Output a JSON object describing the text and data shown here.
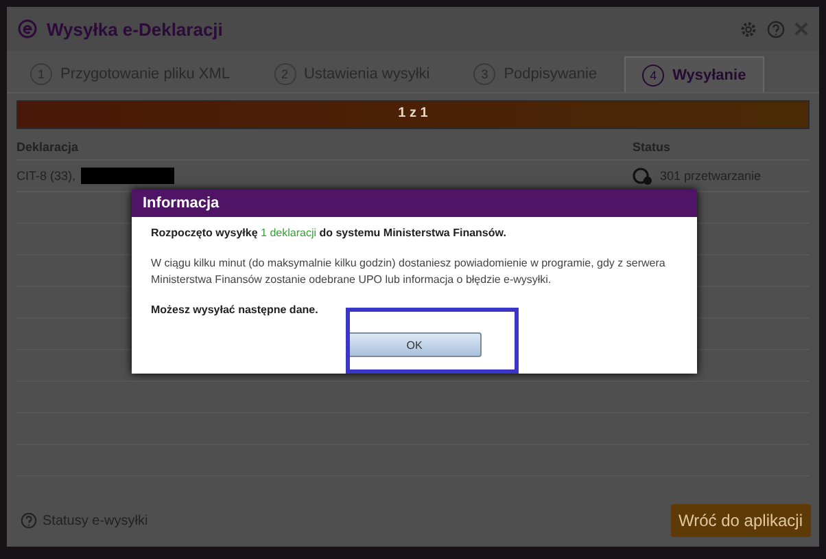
{
  "window": {
    "title": "Wysyłka e-Deklaracji"
  },
  "tabs": [
    {
      "number": "1",
      "label": "Przygotowanie pliku XML",
      "selected": false
    },
    {
      "number": "2",
      "label": "Ustawienia wysyłki",
      "selected": false
    },
    {
      "number": "3",
      "label": "Podpisywanie",
      "selected": false
    },
    {
      "number": "4",
      "label": "Wysyłanie",
      "selected": true
    }
  ],
  "progress": {
    "level": 1,
    "text": "1 z 1"
  },
  "table": {
    "columns": [
      "Deklaracja",
      "Status"
    ],
    "rows": [
      {
        "deklaracja": "CIT-8 (33),",
        "redacted": true,
        "status": "301 przetwarzanie"
      }
    ]
  },
  "footer": {
    "help_link": "Statusy e-wysyłki",
    "back_button": "Wróć do aplikacji"
  },
  "dialog": {
    "title": "Informacja",
    "lines": [
      "**Rozpoczęto wysyłkę** 1 deklaracji **do systemu Ministerstwa Finansów.**",
      "W ciągu kilku minut (do maksymalnie kilku godzin) dostaniesz powiadomienie w programie, gdy z serwera Ministerstwa Finansów zostanie odebrane UPO lub informacja o błędzie e-wysyłki.",
      "**Możesz wysyłać następne dane.**"
    ],
    "ok_button": "OK",
    "ok_highlighted": true
  }
}
